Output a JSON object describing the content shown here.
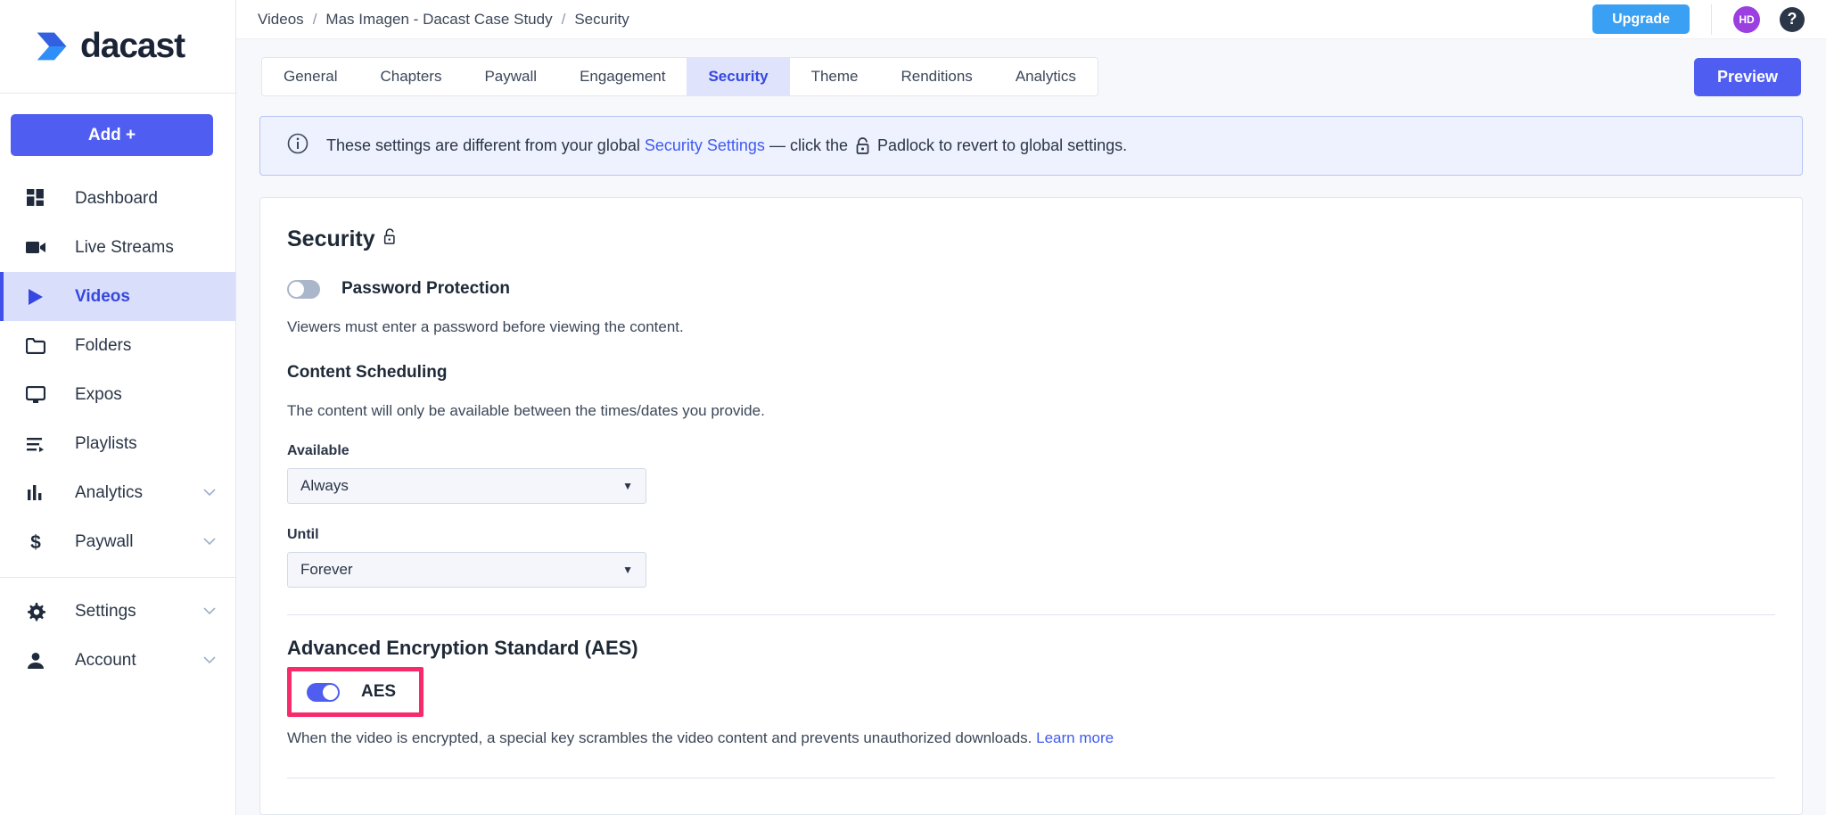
{
  "brand": {
    "name": "dacast",
    "accent": "#4f5ef0",
    "logo_icon": "dacast-arrow-logo"
  },
  "sidebar": {
    "add_button": "Add +",
    "items": [
      {
        "label": "Dashboard",
        "icon": "dashboard-icon",
        "active": false,
        "chevron": false
      },
      {
        "label": "Live Streams",
        "icon": "video-camera-icon",
        "active": false,
        "chevron": false
      },
      {
        "label": "Videos",
        "icon": "play-icon",
        "active": true,
        "chevron": false
      },
      {
        "label": "Folders",
        "icon": "folder-icon",
        "active": false,
        "chevron": false
      },
      {
        "label": "Expos",
        "icon": "monitor-icon",
        "active": false,
        "chevron": false
      },
      {
        "label": "Playlists",
        "icon": "playlist-icon",
        "active": false,
        "chevron": false
      },
      {
        "label": "Analytics",
        "icon": "bar-chart-icon",
        "active": false,
        "chevron": true
      },
      {
        "label": "Paywall",
        "icon": "dollar-icon",
        "active": false,
        "chevron": true
      }
    ],
    "items_bottom": [
      {
        "label": "Settings",
        "icon": "gear-icon",
        "chevron": true
      },
      {
        "label": "Account",
        "icon": "person-icon",
        "chevron": true
      }
    ]
  },
  "topbar": {
    "breadcrumb": [
      "Videos",
      "Mas Imagen - Dacast Case Study",
      "Security"
    ],
    "separator": "/",
    "upgrade_label": "Upgrade",
    "avatar_initials": "HD",
    "avatar_color": "#9b3fe0",
    "help_icon": "question-mark-icon",
    "upgrade_color": "#3aa0f3"
  },
  "tabs": {
    "items": [
      {
        "label": "General",
        "active": false
      },
      {
        "label": "Chapters",
        "active": false
      },
      {
        "label": "Paywall",
        "active": false
      },
      {
        "label": "Engagement",
        "active": false
      },
      {
        "label": "Security",
        "active": true
      },
      {
        "label": "Theme",
        "active": false
      },
      {
        "label": "Renditions",
        "active": false
      },
      {
        "label": "Analytics",
        "active": false
      }
    ],
    "preview_label": "Preview"
  },
  "banner": {
    "icon": "info-circle-icon",
    "text_before": "These settings are different from your global",
    "link": "Security Settings",
    "text_middle": "— click the",
    "padlock_icon": "padlock-icon",
    "text_after": "Padlock to revert to global settings."
  },
  "security": {
    "title": "Security",
    "title_icon": "unlocked-padlock-icon",
    "password_protection": {
      "label": "Password Protection",
      "state": "off",
      "description": "Viewers must enter a password before viewing the content."
    },
    "content_scheduling": {
      "heading": "Content Scheduling",
      "description": "The content will only be available between the times/dates you provide.",
      "available_label": "Available",
      "available_value": "Always",
      "until_label": "Until",
      "until_value": "Forever",
      "caret_icon": "caret-down-icon"
    },
    "aes": {
      "heading": "Advanced Encryption Standard (AES)",
      "toggle_label": "AES",
      "state": "on",
      "highlight_color": "#f72b6c",
      "description": "When the video is encrypted, a special key scrambles the video content and prevents unauthorized downloads.",
      "learn_more": "Learn more"
    }
  }
}
